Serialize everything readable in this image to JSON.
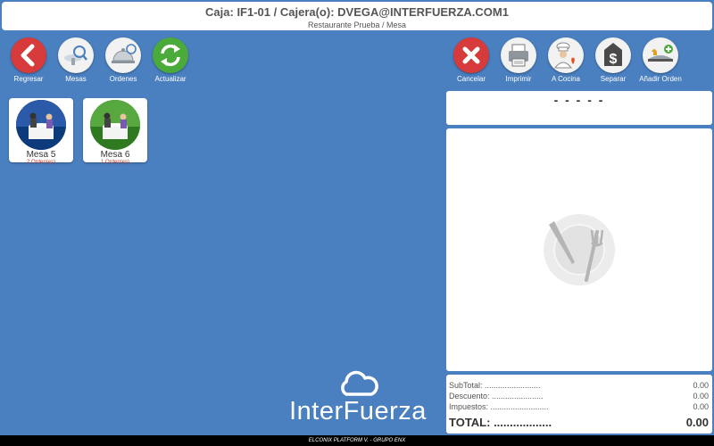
{
  "header": {
    "title": "Caja: IF1-01 / Cajera(o): DVEGA@INTERFUERZA.COM1",
    "subtitle": "Restaurante Prueba / Mesa"
  },
  "toolbar_left": [
    {
      "label": "Regresar",
      "icon": "back-arrow-icon"
    },
    {
      "label": "Mesas",
      "icon": "tables-search-icon"
    },
    {
      "label": "Ordenes",
      "icon": "orders-icon"
    },
    {
      "label": "Actualizar",
      "icon": "refresh-icon"
    }
  ],
  "toolbar_right": [
    {
      "label": "Cancelar",
      "icon": "cancel-x-icon"
    },
    {
      "label": "Imprimir",
      "icon": "printer-icon"
    },
    {
      "label": "A Cocina",
      "icon": "chef-icon"
    },
    {
      "label": "Separar",
      "icon": "dollar-icon"
    },
    {
      "label": "Añadir Orden",
      "icon": "add-order-tray-icon"
    }
  ],
  "tables": [
    {
      "name": "Mesa 5",
      "orders": "2 Orden(es)",
      "color": "#0c3a7a"
    },
    {
      "name": "Mesa 6",
      "orders": "1 Orden(es)",
      "color": "#3f8f2c"
    }
  ],
  "order_panel": {
    "header": "- - - - -"
  },
  "totals": {
    "subtotal_label": "SubTotal: .........................",
    "subtotal_value": "0.00",
    "discount_label": "Descuento: .......................",
    "discount_value": "0.00",
    "tax_label": "Impuestos: ..........................",
    "tax_value": "0.00",
    "total_label": "TOTAL: ..................",
    "total_value": "0.00"
  },
  "brand": "InterFuerza",
  "footer": "ELCONIX PLATFORM V. - GRUPO ENX",
  "colors": {
    "background": "#4a7fc0",
    "red": "#d63a3a",
    "green": "#4aaa3a"
  }
}
